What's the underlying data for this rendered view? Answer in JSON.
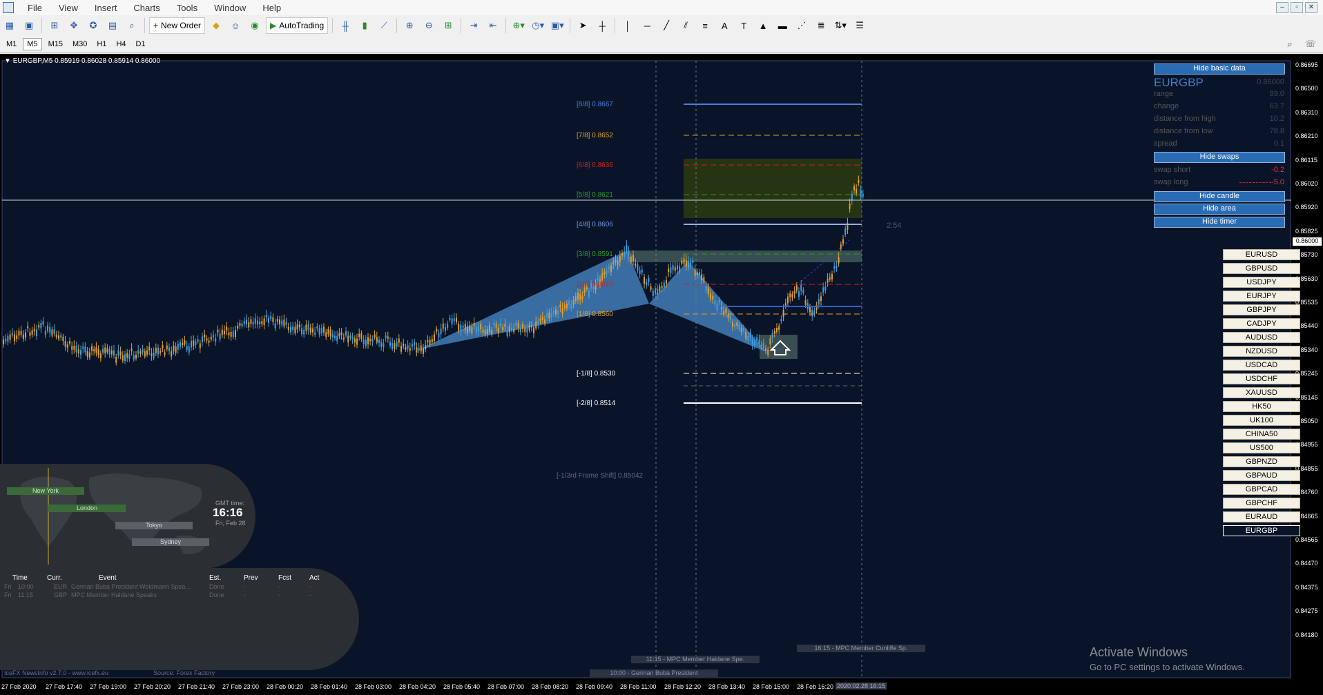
{
  "menu": [
    "File",
    "View",
    "Insert",
    "Charts",
    "Tools",
    "Window",
    "Help"
  ],
  "window_controls": [
    "–",
    "▫",
    "✕"
  ],
  "toolbar": {
    "new_order_label": "New Order",
    "autotrading_label": "AutoTrading"
  },
  "timeframes": [
    {
      "label": "M1",
      "active": false
    },
    {
      "label": "M5",
      "active": true
    },
    {
      "label": "M15",
      "active": false
    },
    {
      "label": "M30",
      "active": false
    },
    {
      "label": "H1",
      "active": false
    },
    {
      "label": "H4",
      "active": false
    },
    {
      "label": "D1",
      "active": false
    }
  ],
  "chart": {
    "title": "EURGBP,M5  0.85919 0.86028 0.85914 0.86000",
    "current_price": "0.86000",
    "timer_text": "2:54",
    "price_axis": [
      "0.86695",
      "0.86500",
      "0.86310",
      "0.86210",
      "0.86115",
      "0.86020",
      "0.85920",
      "0.85825",
      "0.85730",
      "0.85630",
      "0.85535",
      "0.85440",
      "0.85340",
      "0.85245",
      "0.85145",
      "0.85050",
      "0.84955",
      "0.84855",
      "0.84760",
      "0.84665",
      "0.84565",
      "0.84470",
      "0.84375",
      "0.84275",
      "0.84180"
    ],
    "time_axis": [
      "27 Feb 2020",
      "27 Feb 17:40",
      "27 Feb 19:00",
      "27 Feb 20:20",
      "27 Feb 21:40",
      "27 Feb 23:00",
      "28 Feb 00:20",
      "28 Feb 01:40",
      "28 Feb 03:00",
      "28 Feb 04:20",
      "28 Feb 05:40",
      "28 Feb 07:00",
      "28 Feb 08:20",
      "28 Feb 09:40",
      "28 Feb 11:00",
      "28 Feb 12:20",
      "28 Feb 13:40",
      "28 Feb 15:00",
      "28 Feb 16:20",
      "2020.02.28 16:15"
    ],
    "murrey_levels": [
      {
        "label": "[8/8]  0.8667",
        "color": "#4a7de0"
      },
      {
        "label": "[7/8]  0.8652",
        "color": "#e0a030"
      },
      {
        "label": "[6/8]  0.8636",
        "color": "#d02020"
      },
      {
        "label": "[5/8]  0.8621",
        "color": "#2a9a2a"
      },
      {
        "label": "[4/8]  0.8606",
        "color": "#6a9ae8"
      },
      {
        "label": "[3/8]  0.8591",
        "color": "#2a9a2a"
      },
      {
        "label": "[2/8]  0.8575",
        "color": "#d02020"
      },
      {
        "label": "[1/8]  0.8560",
        "color": "#e0a030"
      },
      {
        "label": "[-1/8]  0.8530",
        "color": "#ffffff"
      },
      {
        "label": "[-2/8]  0.8514",
        "color": "#ffffff"
      }
    ],
    "frame_shift_label": "[-1/3rd Frame Shift]  0.85042",
    "news_tags": [
      "11:15 - MPC Member Haldane Spe.",
      "10:00 - German Buba President",
      "16:15 - MPC Member Cunliffe Sp."
    ]
  },
  "info_panel": {
    "hide_basic": "Hide basic data",
    "symbol": "EURGBP",
    "symbol_price": "0.86000",
    "rows": [
      {
        "label": "range",
        "value": "89.0"
      },
      {
        "label": "change",
        "value": "63.7"
      },
      {
        "label": "distance from high",
        "value": "10.2"
      },
      {
        "label": "distance from low",
        "value": "78.8"
      },
      {
        "label": "spread",
        "value": "0.1"
      }
    ],
    "hide_swaps": "Hide swaps",
    "swap_rows": [
      {
        "label": "swap short",
        "value": "-0.2"
      },
      {
        "label": "swap long",
        "value": "-5.0"
      }
    ],
    "hide_candle": "Hide candle",
    "hide_area": "Hide area",
    "hide_timer": "Hide timer"
  },
  "symbols": [
    "EURUSD",
    "GBPUSD",
    "USDJPY",
    "EURJPY",
    "GBPJPY",
    "CADJPY",
    "AUDUSD",
    "NZDUSD",
    "USDCAD",
    "USDCHF",
    "XAUUSD",
    "HK50",
    "UK100",
    "CHINA50",
    "US500",
    "GBPNZD",
    "GBPAUD",
    "GBPCAD",
    "GBPCHF",
    "EURAUD",
    "EURGBP"
  ],
  "selected_symbol": "EURGBP",
  "sessions": {
    "labels": [
      "New York",
      "London",
      "Tokyo",
      "Sydney"
    ],
    "gmt_label": "GMT time:",
    "gmt_time": "16:16",
    "gmt_date": "Fri, Feb 28"
  },
  "news": {
    "headers": [
      "Time",
      "Curr.",
      "Event",
      "Est.",
      "Prev",
      "Fcst",
      "Act"
    ],
    "rows": [
      [
        "Fri",
        "10:00",
        "EUR",
        "German Buba President Weidmann Spea...",
        "Done",
        "-",
        "-",
        "-"
      ],
      [
        "Fri",
        "11:15",
        "GBP",
        "MPC Member Haldane Speaks",
        "Done",
        "-",
        "-",
        "-"
      ]
    ],
    "footer_left": "IceFX NewsInfo v2.7.0  -  www.icefx.eu",
    "footer_right": "Source: Forex Factory"
  },
  "activate_windows": {
    "title": "Activate Windows",
    "subtitle": "Go to PC settings to activate Windows."
  }
}
